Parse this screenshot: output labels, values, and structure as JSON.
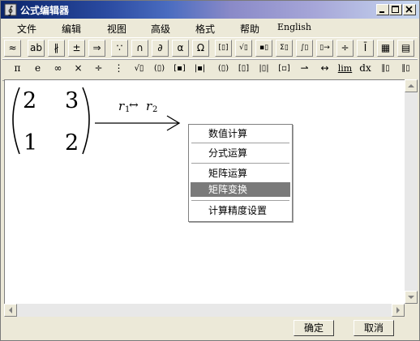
{
  "window": {
    "title": "公式编辑器"
  },
  "menu": [
    "文件",
    "编辑",
    "视图",
    "高级",
    "格式",
    "帮助",
    "English"
  ],
  "toolbar1": [
    "≈",
    "ab",
    "∦",
    "±",
    "⇒",
    "∵",
    "∩",
    "∂",
    "α",
    "Ω",
    "[▯]",
    "√▯",
    "▪▯",
    "Σ▯",
    "∫▯",
    "▯→",
    "÷",
    "Ī",
    "▦",
    "▤"
  ],
  "toolbar2": [
    "π",
    "e",
    "∞",
    "×",
    "÷",
    "⋮",
    "√▯",
    "(▯)",
    "[▪]",
    "|▪|",
    "(▯)",
    "[▯]",
    "|▯|",
    "[▫]",
    "⇀",
    "↔",
    "lim",
    "dx",
    "∥▯",
    "∥▯"
  ],
  "matrix": {
    "cells": [
      "2",
      "3",
      "1",
      "2"
    ]
  },
  "annotation": {
    "r1": "r",
    "sub1": "1",
    "arrow": "↔",
    "r2": "r",
    "sub2": "2"
  },
  "context_menu": {
    "items": [
      "数值计算",
      "分式运算",
      "矩阵运算",
      "矩阵变换",
      "计算精度设置"
    ],
    "active_index": 3
  },
  "buttons": {
    "ok": "确定",
    "cancel": "取消"
  }
}
